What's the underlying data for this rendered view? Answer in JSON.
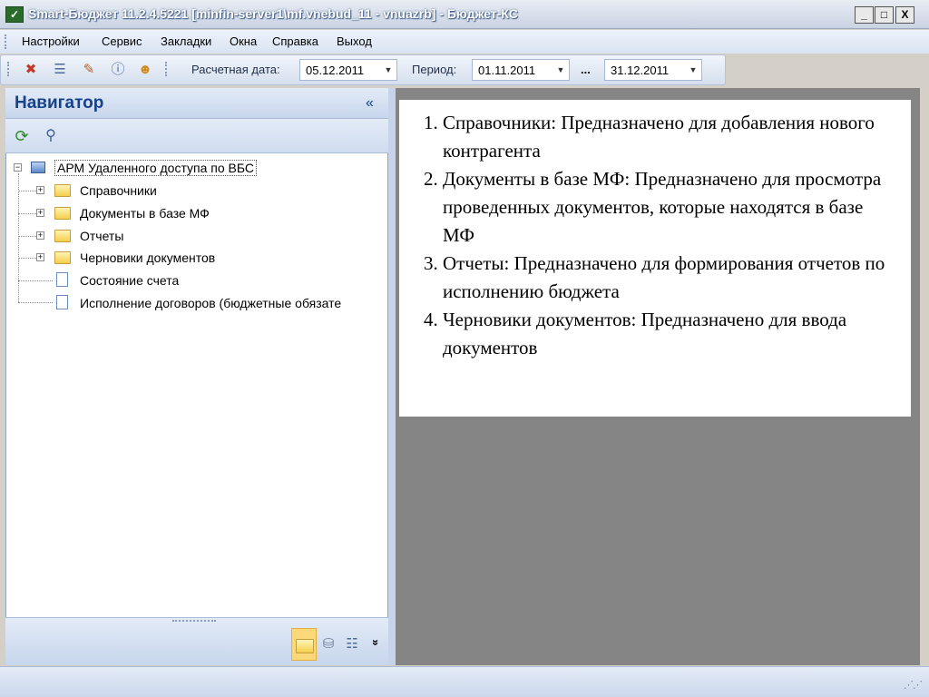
{
  "window": {
    "title": "Smart-Бюджет 11.2.4.5221 [minfin-server1\\mf.vnebud_11 - vnuazrb] - Бюджет-КС",
    "controls": [
      "_",
      "□",
      "X"
    ]
  },
  "menu": [
    "Настройки",
    "Сервис",
    "Закладки",
    "Окна",
    "Справка",
    "Выход"
  ],
  "toolbar": {
    "icons": [
      "delete-doc-icon",
      "list-icon",
      "edit-doc-icon",
      "info-icon",
      "users-icon"
    ],
    "calc_date_label": "Расчетная дата:",
    "calc_date_value": "05.12.2011",
    "period_label": "Период:",
    "period_from": "01.11.2011",
    "period_sep": "...",
    "period_to": "31.12.2011"
  },
  "navigator": {
    "title": "Навигатор",
    "collapse": "«",
    "tools": [
      "refresh-icon",
      "find-icon"
    ],
    "root": "АРМ Удаленного доступа по ВБС",
    "items": [
      {
        "label": "Справочники",
        "type": "folder"
      },
      {
        "label": "Документы в базе МФ",
        "type": "folder"
      },
      {
        "label": "Отчеты",
        "type": "folder"
      },
      {
        "label": "Черновики документов",
        "type": "folder"
      },
      {
        "label": "Состояние счета",
        "type": "doc"
      },
      {
        "label": "Исполнение договоров (бюджетные обязате",
        "type": "doc"
      }
    ],
    "footer_icons": [
      "folder-icon",
      "database-icon",
      "tree-icon",
      "more-icon"
    ],
    "more": "»"
  },
  "content": {
    "items": [
      "Справочники: Предназначено для добавления нового контрагента",
      "Документы в базе МФ: Предназначено для просмотра проведенных документов, которые находятся в базе МФ",
      "Отчеты: Предназначено для формирования отчетов по исполнению бюджета",
      " Черновики документов: Предназначено для ввода документов"
    ]
  },
  "colors": {
    "accent": "#15428b",
    "panel": "#c7d6ec",
    "workspace": "#858585"
  }
}
